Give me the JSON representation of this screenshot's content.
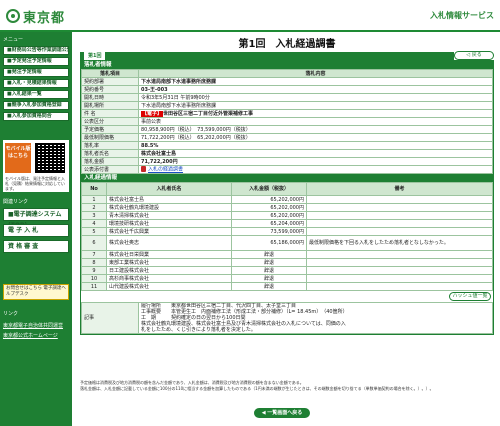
{
  "header": {
    "logo_text": "東京都",
    "service_name": "入札情報サービス"
  },
  "sidebar": {
    "menu_heading": "メニュー",
    "items": [
      "■財務局公告等作業調達公告",
      "■予定発注予定情報",
      "■発注予定情報",
      "■入札・見積結果情報",
      "■入札結果一覧",
      "■競争入札参加資格登録",
      "■入札参加資格問合"
    ],
    "mobile_label": "モバイル版はこちら",
    "mobile_note": "モバイル版は、発注予定情報と入札（見積）結果情報に対応しています。",
    "tools_heading": "関連リンク",
    "big_buttons": [
      "■電子調達システム(TOP)",
      "電 子 入 札",
      "資 格 審 査"
    ],
    "inquiry_text": "お問合せはこちら 電子調達ヘルプデスク",
    "links_heading": "リンク",
    "links": [
      "東京都電子自治体共同運営",
      "東京都公式ホームページ"
    ]
  },
  "main": {
    "page_title": "第1回　入札経過調書",
    "tab_label": "第1回",
    "back_button": "◁ 戻る",
    "info_section": "落札者情報",
    "info_header": [
      "落札項目",
      "落札内容"
    ],
    "info_rows": [
      {
        "k": "契約部署",
        "v": "下水道局南部下水道事務所庶務課",
        "bold": true
      },
      {
        "k": "契約番号",
        "v": "03-王-003",
        "bold": true
      },
      {
        "k": "開札日時",
        "v": "令和3年5月31日 午前9時00分",
        "bold": false
      },
      {
        "k": "開札場所",
        "v": "下水道局南部下水道事務所庶務課",
        "bold": false
      },
      {
        "k": "件 名",
        "v": "世田谷区三宿二丁目付近外管渠補修工事",
        "badge": "【電子】",
        "bold": true
      },
      {
        "k": "公表区分",
        "v": "事前公表",
        "bold": false
      },
      {
        "k": "予定価格",
        "v": "80,958,900円（税込）　73,599,000円（税抜）",
        "bold": false
      },
      {
        "k": "最低制限価格",
        "v": "71,722,200円（税込）　65,202,000円（税抜）",
        "bold": false
      },
      {
        "k": "落札率",
        "v": "88.5%",
        "bold": true
      },
      {
        "k": "落札者氏名",
        "v": "株式会社富士島",
        "bold": true
      },
      {
        "k": "落札金額",
        "v": "71,722,200円",
        "bold": true
      },
      {
        "k": "公表添付書",
        "v": "入札の経過調書",
        "pdf": true,
        "bold": false
      }
    ],
    "result_section": "入札経過情報",
    "result_header": [
      "No",
      "入札者氏名",
      "入札金額（税抜）",
      "備考"
    ],
    "results": [
      {
        "no": "1",
        "name": "株式会社富士島",
        "amount": "65,202,000円",
        "note": ""
      },
      {
        "no": "2",
        "name": "株式会社鶴丸環境建設",
        "amount": "65,202,000円",
        "note": ""
      },
      {
        "no": "3",
        "name": "青木清掃株式会社",
        "amount": "65,202,000円",
        "note": ""
      },
      {
        "no": "4",
        "name": "環境技研株式会社",
        "amount": "65,204,000円",
        "note": ""
      },
      {
        "no": "5",
        "name": "株式会社千広興業",
        "amount": "73,599,000円",
        "note": ""
      },
      {
        "no": "6",
        "name": "株式会社奥志",
        "amount": "65,186,000円",
        "note": "最低制限価格を下回る入札をしたため落札者となしなかった。",
        "tall": true
      },
      {
        "no": "7",
        "name": "株式会社日栄興業",
        "amount": "辞退",
        "note": ""
      },
      {
        "no": "8",
        "name": "東部工業株式会社",
        "amount": "辞退",
        "note": ""
      },
      {
        "no": "9",
        "name": "日工建設株式会社",
        "amount": "辞退",
        "note": ""
      },
      {
        "no": "10",
        "name": "高杉商事株式会社",
        "amount": "辞退",
        "note": ""
      },
      {
        "no": "11",
        "name": "山代建設株式会社",
        "amount": "辞退",
        "note": ""
      }
    ],
    "history_button": "ハッシュ値一覧",
    "remarks_label": "記事",
    "remarks_lines": [
      "履行場所　　東京都世田谷区三宿二丁目、代沢四丁目、太子堂三丁目",
      "工事概要　　本管更生工　内面補修工法（形成工法・部分補修）（L= 18.45m）　（40箇所）",
      "工　期　　　契約確定の日の翌日から100日間",
      "株式会社鶴丸環境建設、株式会社富士島及び青木清掃株式会社の入札については、同価の入",
      "札をしたため、くじ引きにより落札者を決定した。"
    ]
  },
  "footnotes": [
    "予定価格は消費税及び地方消費税の額を含んだ金額であり、入札金額は、消費税及び地方消費税の額を含まない金額である。",
    "落札金額は、入札金額に記載している金額に100分の110に相当する金額を加算したものである（1円未満の端数が生じたときは、その端数金額を切り捨てる（単数単価契約の場合を除く。）。）。"
  ],
  "return_button": "◀ 一覧画面へ戻る"
}
